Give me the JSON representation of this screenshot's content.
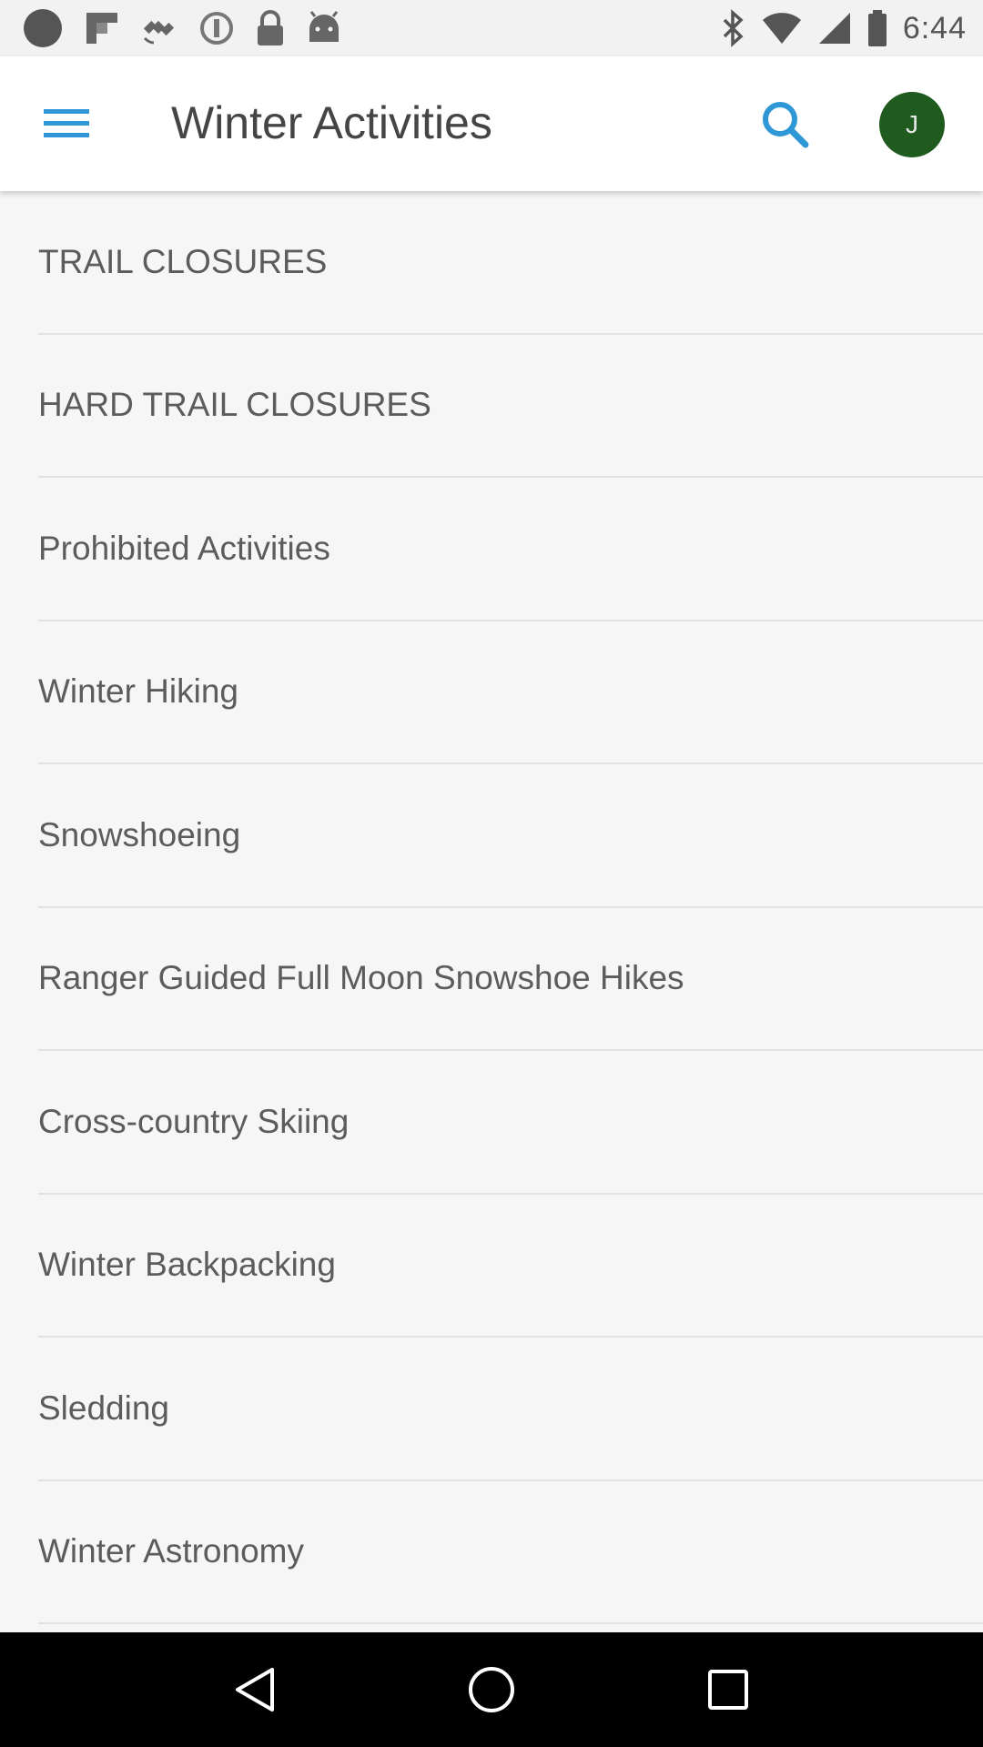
{
  "status_bar": {
    "time": "6:44",
    "icons": [
      "dot-icon",
      "flipboard-icon",
      "satellite-icon",
      "data-saver-icon",
      "lock-icon",
      "android-icon",
      "bluetooth-icon",
      "wifi-icon",
      "signal-icon",
      "battery-icon"
    ]
  },
  "app_bar": {
    "title": "Winter Activities",
    "menu_icon": "hamburger-menu-icon",
    "search_icon": "search-icon",
    "avatar_initial": "J",
    "colors": {
      "search": "#2f97d6",
      "avatar": "#1f5a1f"
    }
  },
  "list": {
    "items": [
      {
        "label": "TRAIL CLOSURES"
      },
      {
        "label": "HARD TRAIL CLOSURES"
      },
      {
        "label": "Prohibited Activities"
      },
      {
        "label": "Winter Hiking"
      },
      {
        "label": "Snowshoeing"
      },
      {
        "label": "Ranger Guided Full Moon Snowshoe Hikes"
      },
      {
        "label": "Cross-country Skiing"
      },
      {
        "label": "Winter Backpacking"
      },
      {
        "label": "Sledding"
      },
      {
        "label": "Winter Astronomy"
      }
    ]
  },
  "nav_bar": {
    "back_icon": "back-triangle-icon",
    "home_icon": "home-circle-icon",
    "recents_icon": "recents-square-icon"
  }
}
